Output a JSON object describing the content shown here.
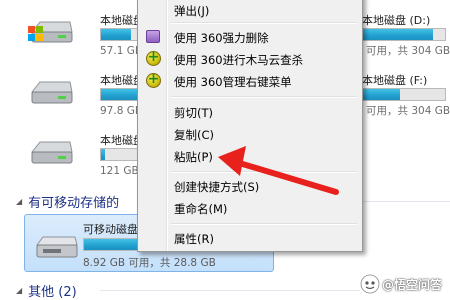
{
  "drives": [
    {
      "name": "本地磁盘",
      "info": "57.1 GB 可用，",
      "fill": 0.6
    },
    {
      "name": "本地磁盘 (",
      "info": "97.8 GB 可用，",
      "fill": 0.35
    },
    {
      "name": "本地磁盘",
      "info": "121 GB 可用，",
      "fill": 0.05
    },
    {
      "name": "本地磁盘 (D:)",
      "info": "可用，共 304 GB",
      "fill": 0.85
    },
    {
      "name": "本地磁盘 (F:)",
      "info": "可用，共 304 GB",
      "fill": 0.45
    }
  ],
  "removable": {
    "name": "可移动磁盘",
    "info": "8.92 GB 可用，共 28.8 GB",
    "fill": 0.68
  },
  "groups": {
    "removable_label": "有可移动存储的",
    "other_label": "其他 (2)"
  },
  "menu": {
    "eject": "弹出(J)",
    "shred": "使用 360强力删除",
    "scan": "使用 360进行木马云查杀",
    "manage": "使用 360管理右键菜单",
    "cut": "剪切(T)",
    "copy": "复制(C)",
    "paste": "粘贴(P)",
    "shortcut": "创建快捷方式(S)",
    "rename": "重命名(M)",
    "properties": "属性(R)"
  },
  "watermark": {
    "text": "@悟空问答"
  },
  "colors": {
    "arrow": "#e8211c",
    "bar": "#26a3d3",
    "group_text": "#1e3287"
  },
  "icons": {
    "disk": "hard-disk-icon",
    "windows": "windows-logo-icon",
    "usb": "removable-disk-icon"
  }
}
